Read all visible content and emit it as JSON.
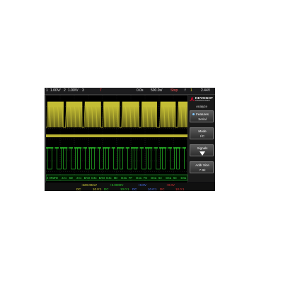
{
  "topbar": {
    "ch1_label": "1",
    "ch1_scale": "1.00V/",
    "ch2_label": "2",
    "ch2_scale": "1.00V/",
    "ch3_label": "3",
    "trigger_marker": "T",
    "time_pos": "0.0s",
    "time_scale": "500.0s/",
    "run_state": "Stop",
    "trig_label": "f",
    "trig_ch": "1",
    "trig_level": "2.44V"
  },
  "decode_labels": [
    "2 0Ra",
    "FD",
    "2Ax",
    "6D",
    "2Ax",
    "BAD",
    "D4x",
    "BAD",
    "D4x",
    "6D",
    "D4a",
    "FF",
    "D4a",
    "FE",
    "D4a",
    "63",
    "D4a",
    "63",
    "D4a"
  ],
  "bottombar": {
    "val_a": "-620.00mV",
    "val_b": "+3.0000V",
    "val_c": "+0.0V",
    "val_d": "+0.0V",
    "dc1": "DC",
    "ratio1": "10.0:1",
    "dc2": "DC",
    "ratio2": "10.0:1",
    "dc3": "DC",
    "ratio3": "10.0:1",
    "dc4": "DC",
    "ratio4": "10.0:1"
  },
  "side": {
    "brand_name": "KEYSIGHT",
    "brand_sub": "TECHNOLOGIES",
    "title": "Analyze",
    "features_label": "Features",
    "features_value": "Serial",
    "mode_label": "Mode",
    "mode_value": "I²C",
    "signals_label": "Signals",
    "addr_label": "Addr Size",
    "addr_value": "7 Bit"
  },
  "colors": {
    "ch1": "#d9d23a",
    "ch2": "#2bd12b",
    "ch3": "#4f7bff",
    "ch4": "#e23636",
    "decode": "#3ad14a",
    "brand_red": "#e4002b"
  }
}
